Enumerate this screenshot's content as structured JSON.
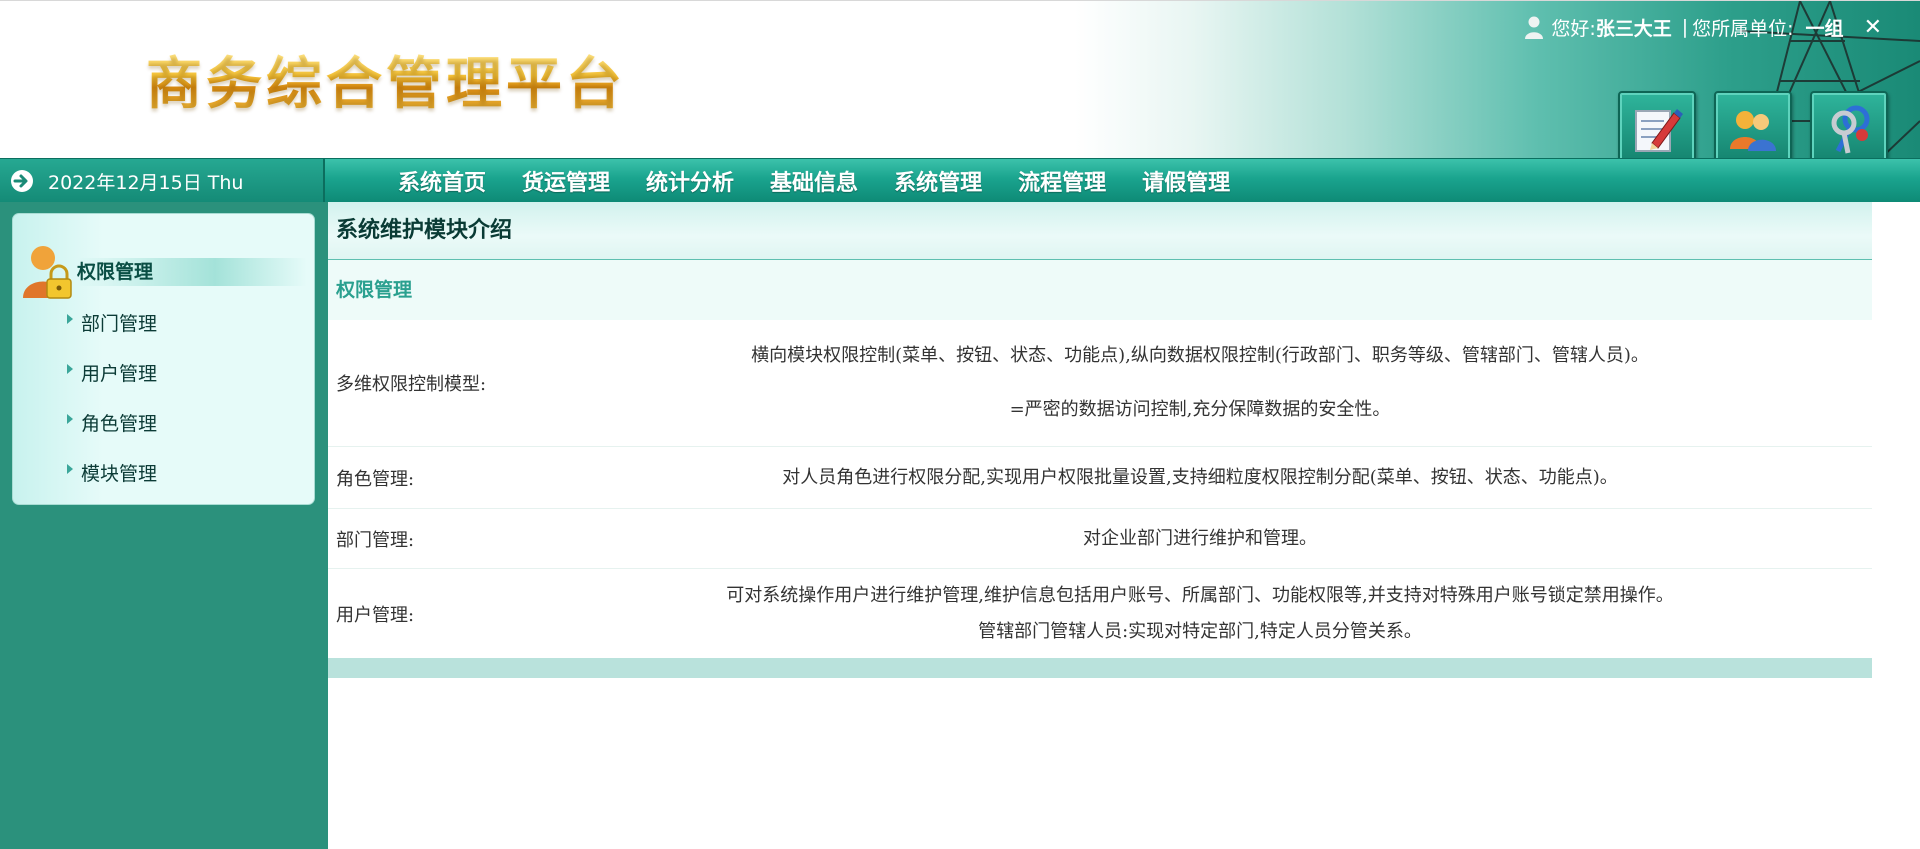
{
  "header": {
    "logo_text": "商务综合管理平台",
    "greeting": "您好:",
    "user_name": "张三大王",
    "separator": "|",
    "unit_label": "您所属单位:",
    "unit_name": "一组",
    "close_symbol": "✕",
    "tool_buttons": [
      {
        "icon": "edit-icon"
      },
      {
        "icon": "users-icon"
      },
      {
        "icon": "keys-icon"
      }
    ]
  },
  "navbar": {
    "date_text": "2022年12月15日 Thu",
    "items": [
      "系统首页",
      "货运管理",
      "统计分析",
      "基础信息",
      "系统管理",
      "流程管理",
      "请假管理"
    ]
  },
  "sidebar": {
    "title": "权限管理",
    "items": [
      "部门管理",
      "用户管理",
      "角色管理",
      "模块管理"
    ]
  },
  "main": {
    "title": "系统维护模块介绍",
    "section_title": "权限管理",
    "rows": [
      {
        "label": "多维权限控制模型:",
        "lines": [
          "横向模块权限控制(菜单、按钮、状态、功能点),纵向数据权限控制(行政部门、职务等级、管辖部门、管辖人员)。",
          "=严密的数据访问控制,充分保障数据的安全性。"
        ]
      },
      {
        "label": "角色管理:",
        "lines": [
          "对人员角色进行权限分配,实现用户权限批量设置,支持细粒度权限控制分配(菜单、按钮、状态、功能点)。"
        ]
      },
      {
        "label": "部门管理:",
        "lines": [
          "对企业部门进行维护和管理。"
        ]
      },
      {
        "label": "用户管理:",
        "lines": [
          "可对系统操作用户进行维护管理,维护信息包括用户账号、所属部门、功能权限等,并支持对特殊用户账号锁定禁用操作。",
          "管辖部门管辖人员:实现对特定部门,特定人员分管关系。"
        ]
      }
    ]
  },
  "colors": {
    "primary": "#1aa48e",
    "sidebar_bg": "#2b917c",
    "section_title": "#2aa08f",
    "logo_gold": "#f2b928"
  }
}
